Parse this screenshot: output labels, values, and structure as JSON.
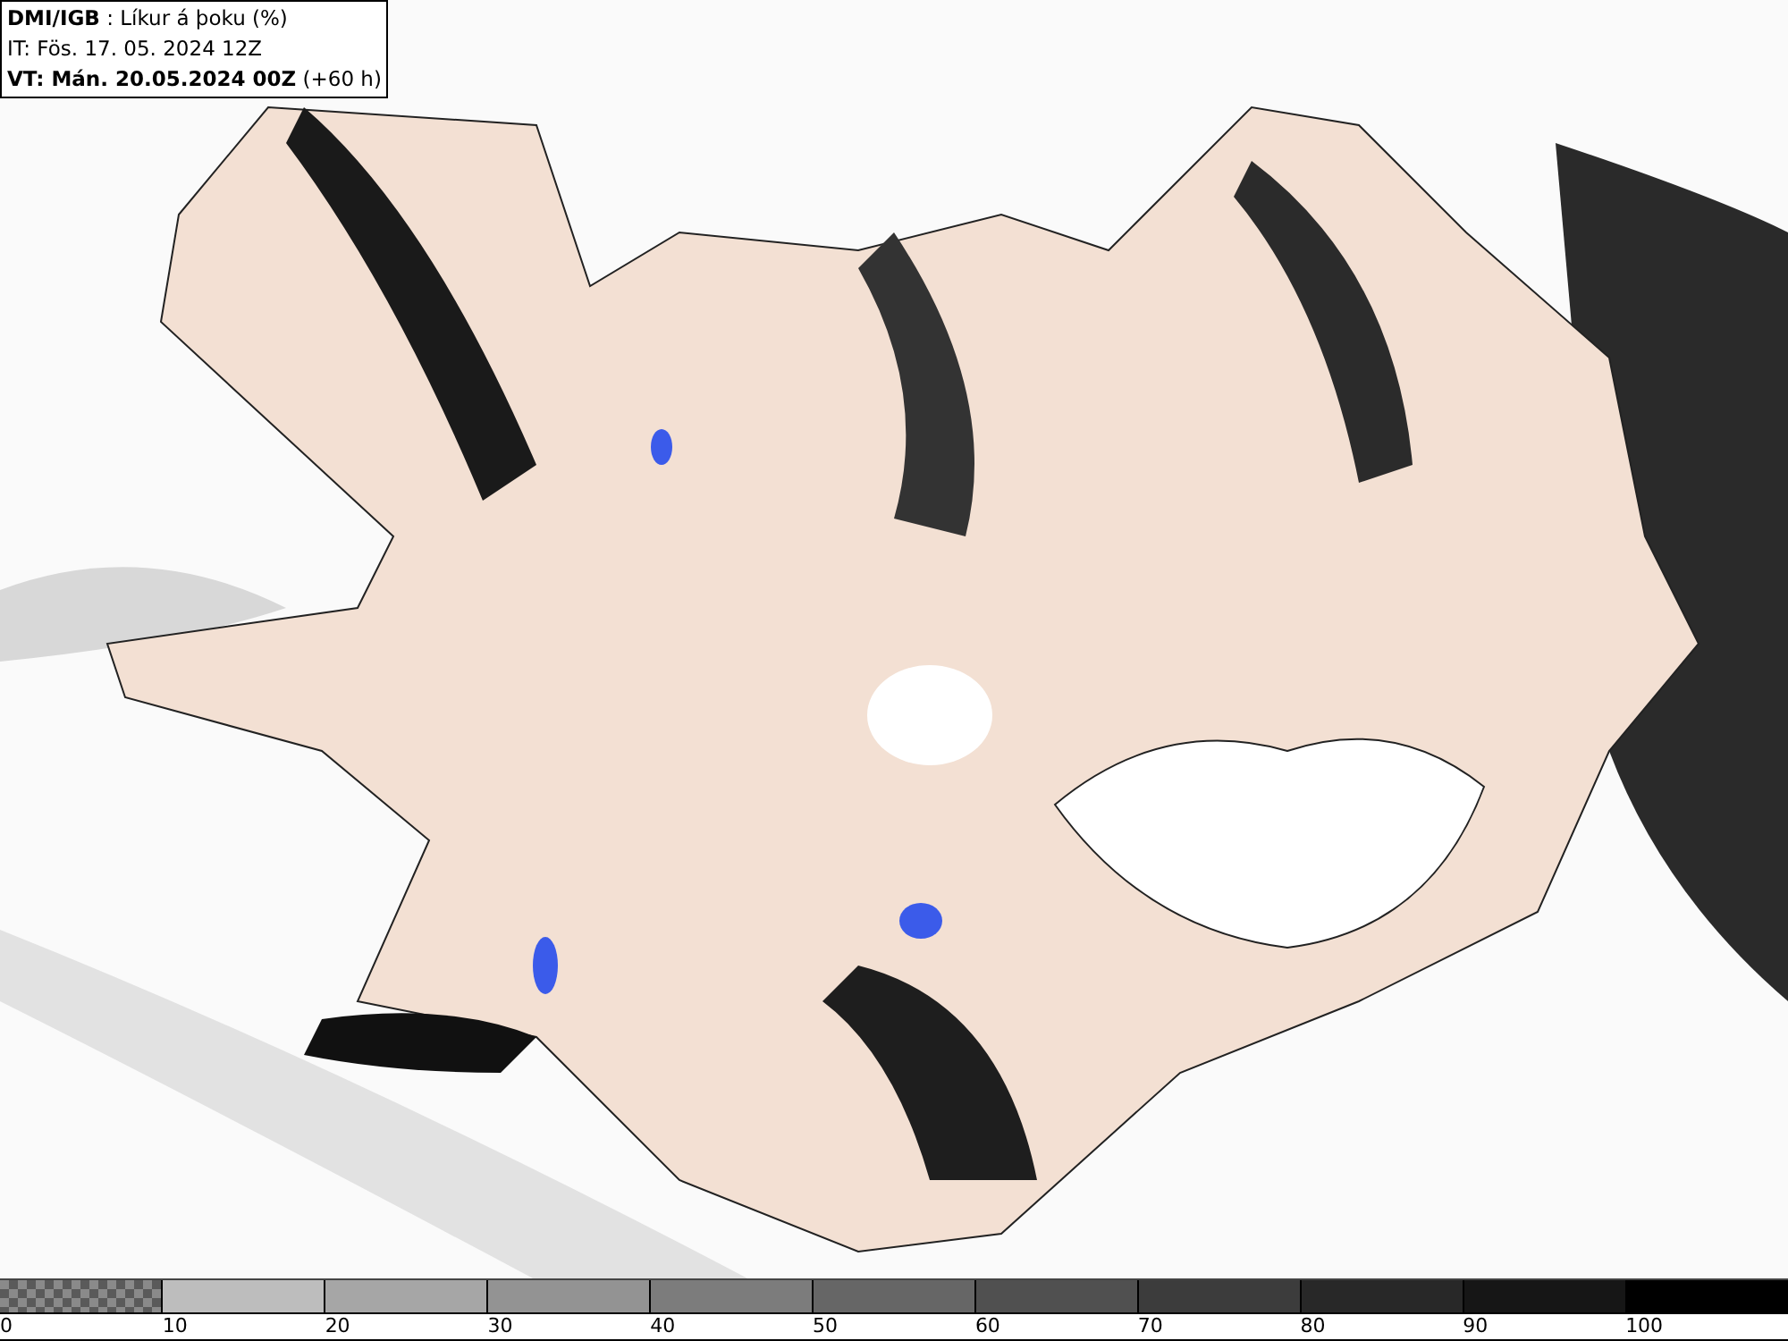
{
  "header": {
    "lines": [
      "**DMI/IGB** : Líkur á þoku (%)",
      "IT: Fös. 17. 05. 2024 12Z",
      "**VT: Mán. 20.05.2024 00Z** (+60 h)"
    ]
  },
  "legend": {
    "segments": [
      {
        "kind": "checker",
        "color": "#5a5a5a"
      },
      {
        "kind": "solid",
        "color": "#bdbdbd"
      },
      {
        "kind": "solid",
        "color": "#a6a6a6"
      },
      {
        "kind": "solid",
        "color": "#939393"
      },
      {
        "kind": "solid",
        "color": "#7c7c7c"
      },
      {
        "kind": "solid",
        "color": "#666666"
      },
      {
        "kind": "solid",
        "color": "#505050"
      },
      {
        "kind": "solid",
        "color": "#3c3c3c"
      },
      {
        "kind": "solid",
        "color": "#282828"
      },
      {
        "kind": "solid",
        "color": "#161616"
      },
      {
        "kind": "solid",
        "color": "#000000"
      }
    ],
    "labels": [
      "0",
      "10",
      "20",
      "30",
      "40",
      "50",
      "60",
      "70",
      "80",
      "90",
      "100"
    ]
  }
}
